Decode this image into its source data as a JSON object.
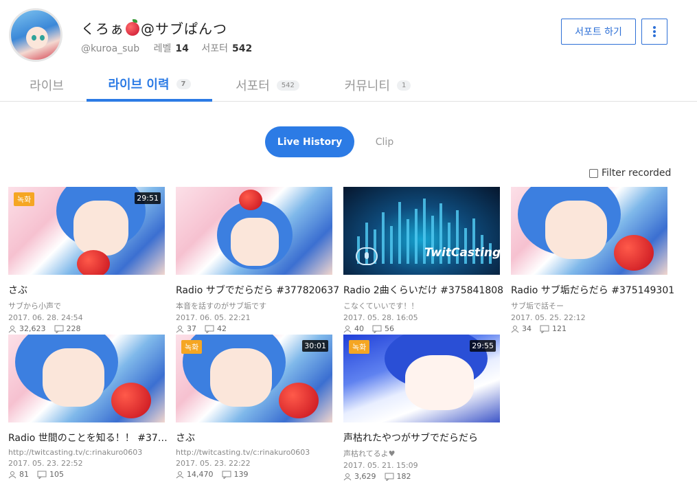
{
  "profile": {
    "name_pre": "くろぁ",
    "name_post": "@サブぱんつ",
    "handle": "@kuroa_sub",
    "level_label": "레벨",
    "level": "14",
    "supporter_label": "서포터",
    "supporters": "542",
    "support_button": "서포트 하기"
  },
  "tabs": [
    {
      "label": "라이브",
      "count": ""
    },
    {
      "label": "라이브 이력",
      "count": "7"
    },
    {
      "label": "서포터",
      "count": "542"
    },
    {
      "label": "커뮤니티",
      "count": "1"
    }
  ],
  "subtabs": {
    "history": "Live History",
    "clip": "Clip"
  },
  "filter_label": "Filter recorded",
  "cards": [
    {
      "title": "さぶ",
      "desc": "サブから小声で",
      "date": "2017. 06. 28. 24:54",
      "views": "32,623",
      "comments": "228",
      "recorded": "녹화",
      "duration": "29:51"
    },
    {
      "title": "Radio サブでだらだら #377820637",
      "desc": "本音を話すのがサブ垢です",
      "date": "2017. 06. 05. 22:21",
      "views": "37",
      "comments": "42",
      "recorded": "",
      "duration": ""
    },
    {
      "title": "Radio 2曲くらいだけ #375841808",
      "desc": "こなくていいです！！",
      "date": "2017. 05. 28. 16:05",
      "views": "40",
      "comments": "56",
      "recorded": "",
      "duration": "",
      "thumb_text": "TwitCasting"
    },
    {
      "title": "Radio サブ垢だらだら #375149301",
      "desc": "サブ垢で話そー",
      "date": "2017. 05. 25. 22:12",
      "views": "34",
      "comments": "121",
      "recorded": "",
      "duration": ""
    },
    {
      "title": "Radio 世間のことを知る！！ #374...",
      "desc": "http://twitcasting.tv/c:rinakuro0603",
      "date": "2017. 05. 23. 22:52",
      "views": "81",
      "comments": "105",
      "recorded": "",
      "duration": ""
    },
    {
      "title": "さぶ",
      "desc": "http://twitcasting.tv/c:rinakuro0603",
      "date": "2017. 05. 23. 22:22",
      "views": "14,470",
      "comments": "139",
      "recorded": "녹화",
      "duration": "30:01"
    },
    {
      "title": "声枯れたやつがサブでだらだら",
      "desc": "声枯れてるよ♥",
      "date": "2017. 05. 21. 15:09",
      "views": "3,629",
      "comments": "182",
      "recorded": "녹화",
      "duration": "29:55"
    }
  ],
  "colors": {
    "accent": "#2c7be5",
    "recorded_badge": "#f5a623"
  }
}
